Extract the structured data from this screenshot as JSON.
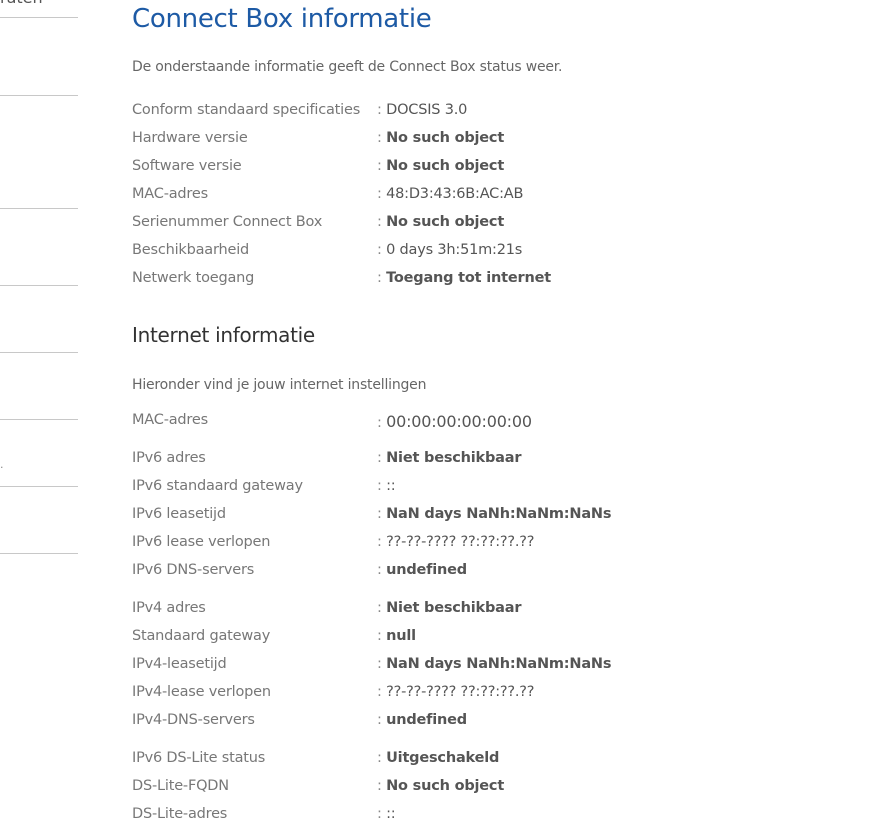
{
  "sidebar": {
    "cut_text": "raten"
  },
  "connect_box": {
    "title": "Connect Box informatie",
    "intro": "De onderstaande informatie geeft de Connect Box status weer.",
    "rows": [
      {
        "label": "Conform standaard specificaties",
        "value": "DOCSIS 3.0"
      },
      {
        "label": "Hardware versie",
        "value": "No such object"
      },
      {
        "label": "Software versie",
        "value": "No such object"
      },
      {
        "label": "MAC-adres",
        "value": "48:D3:43:6B:AC:AB"
      },
      {
        "label": "Serienummer Connect Box",
        "value": "No such object"
      },
      {
        "label": "Beschikbaarheid",
        "value": "0 days 3h:51m:21s"
      },
      {
        "label": "Netwerk toegang",
        "value": "Toegang tot internet"
      }
    ]
  },
  "internet": {
    "title": "Internet informatie",
    "intro": "Hieronder vind je jouw internet instellingen",
    "mac": {
      "label": "MAC-adres",
      "value": "00:00:00:00:00:00"
    },
    "ipv6": [
      {
        "label": "IPv6 adres",
        "value": "Niet beschikbaar"
      },
      {
        "label": "IPv6 standaard gateway",
        "value": "::"
      },
      {
        "label": "IPv6 leasetijd",
        "value": "NaN days NaNh:NaNm:NaNs"
      },
      {
        "label": "IPv6 lease verlopen",
        "value": "??-??-???? ??:??:??.??"
      },
      {
        "label": "IPv6 DNS-servers",
        "value": "undefined"
      }
    ],
    "ipv4": [
      {
        "label": "IPv4 adres",
        "value": "Niet beschikbaar"
      },
      {
        "label": "Standaard gateway",
        "value": "null"
      },
      {
        "label": "IPv4-leasetijd",
        "value": "NaN days NaNh:NaNm:NaNs"
      },
      {
        "label": "IPv4-lease verlopen",
        "value": "??-??-???? ??:??:??.??"
      },
      {
        "label": "IPv4-DNS-servers",
        "value": "undefined"
      }
    ],
    "dslite": [
      {
        "label": "IPv6 DS-Lite status",
        "value": "Uitgeschakeld"
      },
      {
        "label": "DS-Lite-FQDN",
        "value": "No such object"
      },
      {
        "label": "DS-Lite-adres",
        "value": "::"
      }
    ]
  }
}
